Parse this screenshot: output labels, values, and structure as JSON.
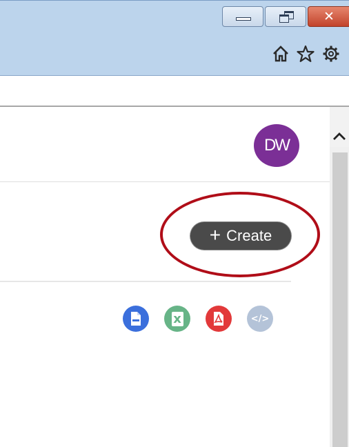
{
  "window": {
    "minimize_icon": "minimize-icon",
    "restore_icon": "restore-icon",
    "close_glyph": "✕"
  },
  "toolbar": {
    "icons": [
      "home-icon",
      "star-icon",
      "gear-icon"
    ]
  },
  "header": {
    "avatar_initials": "DW",
    "avatar_color": "#7b2f96"
  },
  "actions": {
    "create_plus": "+",
    "create_label": "Create"
  },
  "exports": {
    "csv_icon": "csv-file-icon",
    "excel_label": "x",
    "pdf_icon": "pdf-file-icon",
    "code_label": "</>",
    "colors": {
      "csv": "#3b6fdc",
      "excel": "#67b487",
      "pdf": "#e2393a",
      "code": "#b4c3d8"
    }
  },
  "annotation": {
    "color": "#b00d18"
  }
}
